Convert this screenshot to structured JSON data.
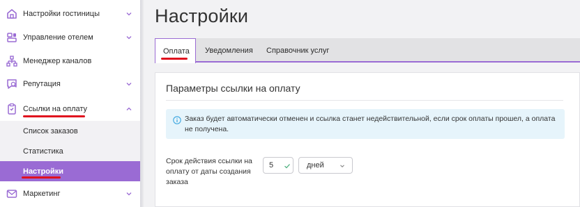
{
  "sidebar": {
    "items": [
      {
        "label": "Настройки гостиницы",
        "icon": "home-icon"
      },
      {
        "label": "Управление отелем",
        "icon": "hotel-management-icon"
      },
      {
        "label": "Менеджер каналов",
        "icon": "channel-manager-icon"
      },
      {
        "label": "Репутация",
        "icon": "reputation-icon"
      },
      {
        "label": "Ссылки на оплату",
        "icon": "payment-links-icon"
      },
      {
        "label": "Маркетинг",
        "icon": "mail-icon"
      }
    ],
    "subitems": [
      {
        "label": "Список заказов"
      },
      {
        "label": "Статистика"
      },
      {
        "label": "Настройки"
      }
    ]
  },
  "page": {
    "title": "Настройки"
  },
  "tabs": [
    {
      "label": "Оплата",
      "active": true
    },
    {
      "label": "Уведомления"
    },
    {
      "label": "Справочник услуг"
    }
  ],
  "card": {
    "title": "Параметры ссылки на оплату",
    "info": "Заказ будет автоматически отменен и ссылка станет недействительной, если срок оплаты прошел, а оплата не получена.",
    "field_label": "Срок действия ссылки на оплату от даты создания заказа",
    "days_value": "5",
    "unit_selected": "дней"
  },
  "colors": {
    "accent": "#9a6bd4",
    "highlight": "#e0101e",
    "info_bg": "#e6f4fb",
    "check": "#4caf7d"
  }
}
